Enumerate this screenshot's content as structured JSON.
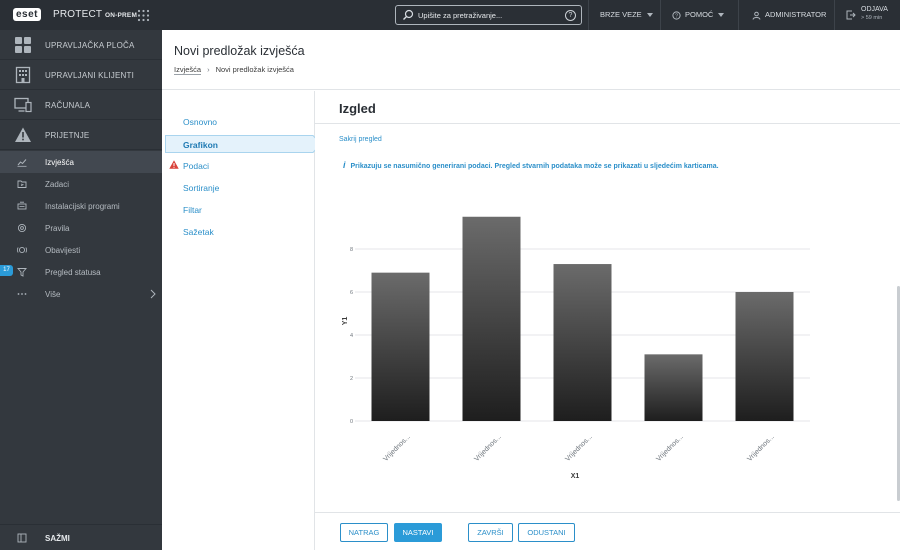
{
  "topbar": {
    "logo": "eset",
    "product": "PROTECT",
    "product_sub": "ON-PREM",
    "search_placeholder": "Upišite za pretraživanje...",
    "quick_links": "BRZE VEZE",
    "help": "POMOĆ",
    "user": "ADMINISTRATOR",
    "logout": "ODJAVA",
    "logout_time": "> 59 min"
  },
  "sidebar": {
    "main": [
      {
        "label": "UPRAVLJAČKA PLOČA",
        "icon": "dashboard-icon"
      },
      {
        "label": "UPRAVLJANI KLIJENTI",
        "icon": "building-icon"
      },
      {
        "label": "RAČUNALA",
        "icon": "computer-icon"
      },
      {
        "label": "PRIJETNJE",
        "icon": "warning-icon"
      }
    ],
    "sub": [
      {
        "label": "Izvješća",
        "icon": "reports-icon"
      },
      {
        "label": "Zadaci",
        "icon": "tasks-icon"
      },
      {
        "label": "Instalacijski programi",
        "icon": "installer-icon"
      },
      {
        "label": "Pravila",
        "icon": "policy-icon"
      },
      {
        "label": "Obavijesti",
        "icon": "notification-icon"
      },
      {
        "label": "Pregled statusa",
        "icon": "status-icon"
      },
      {
        "label": "Više",
        "icon": "more-icon"
      }
    ],
    "status_badge": "17",
    "collapse": "SAŽMI"
  },
  "page": {
    "title": "Novi predložak izvješća",
    "breadcrumb": [
      "Izvješća",
      "Novi predložak izvješća"
    ]
  },
  "wizard": {
    "steps": [
      "Osnovno",
      "Grafikon",
      "Podaci",
      "Sortiranje",
      "Filtar",
      "Sažetak"
    ],
    "active": "Grafikon"
  },
  "content": {
    "section_title": "Izgled",
    "hide_preview": "Sakrij pregled",
    "info": "Prikazuju se nasumično generirani podaci. Pregled stvarnih podataka može se prikazati u sljedećim karticama."
  },
  "chart_data": {
    "type": "bar",
    "categories": [
      "Vrijednos...",
      "Vrijednos...",
      "Vrijednos...",
      "Vrijednos...",
      "Vrijednos..."
    ],
    "values": [
      6.9,
      9.5,
      7.3,
      3.1,
      6.0
    ],
    "xlabel": "X1",
    "ylabel": "Y1",
    "yticks": [
      0,
      2,
      4,
      6,
      8
    ],
    "ylim": [
      0,
      10
    ],
    "grid": true
  },
  "footer": {
    "back": "NATRAG",
    "next": "NASTAVI",
    "finish": "ZAVRŠI",
    "cancel": "ODUSTANI"
  }
}
